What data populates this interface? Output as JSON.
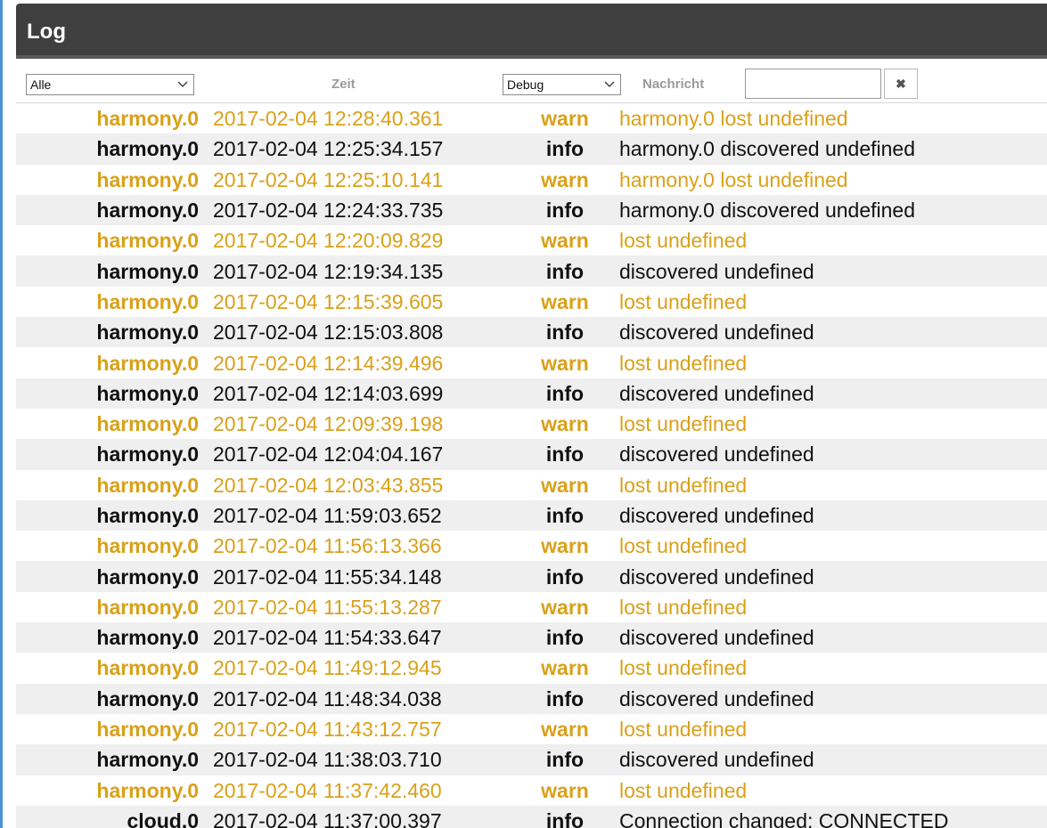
{
  "colors": {
    "warn": "#d9a11a",
    "info": "#111111",
    "header_bg": "#3f3f3f"
  },
  "panel": {
    "title": "Log"
  },
  "filters": {
    "source": {
      "selected": "Alle"
    },
    "time_header": "Zeit",
    "severity": {
      "selected": "Debug"
    },
    "message_header": "Nachricht",
    "message_filter_value": "",
    "clear_icon": "close-icon",
    "clear_glyph": "✖"
  },
  "log_rows": [
    {
      "source": "harmony.0",
      "time": "2017-02-04 12:28:40.361",
      "severity": "warn",
      "message": "harmony.0 lost undefined"
    },
    {
      "source": "harmony.0",
      "time": "2017-02-04 12:25:34.157",
      "severity": "info",
      "message": "harmony.0 discovered undefined"
    },
    {
      "source": "harmony.0",
      "time": "2017-02-04 12:25:10.141",
      "severity": "warn",
      "message": "harmony.0 lost undefined"
    },
    {
      "source": "harmony.0",
      "time": "2017-02-04 12:24:33.735",
      "severity": "info",
      "message": "harmony.0 discovered undefined"
    },
    {
      "source": "harmony.0",
      "time": "2017-02-04 12:20:09.829",
      "severity": "warn",
      "message": "lost undefined"
    },
    {
      "source": "harmony.0",
      "time": "2017-02-04 12:19:34.135",
      "severity": "info",
      "message": "discovered undefined"
    },
    {
      "source": "harmony.0",
      "time": "2017-02-04 12:15:39.605",
      "severity": "warn",
      "message": "lost undefined"
    },
    {
      "source": "harmony.0",
      "time": "2017-02-04 12:15:03.808",
      "severity": "info",
      "message": "discovered undefined"
    },
    {
      "source": "harmony.0",
      "time": "2017-02-04 12:14:39.496",
      "severity": "warn",
      "message": "lost undefined"
    },
    {
      "source": "harmony.0",
      "time": "2017-02-04 12:14:03.699",
      "severity": "info",
      "message": "discovered undefined"
    },
    {
      "source": "harmony.0",
      "time": "2017-02-04 12:09:39.198",
      "severity": "warn",
      "message": "lost undefined"
    },
    {
      "source": "harmony.0",
      "time": "2017-02-04 12:04:04.167",
      "severity": "info",
      "message": "discovered undefined"
    },
    {
      "source": "harmony.0",
      "time": "2017-02-04 12:03:43.855",
      "severity": "warn",
      "message": "lost undefined"
    },
    {
      "source": "harmony.0",
      "time": "2017-02-04 11:59:03.652",
      "severity": "info",
      "message": "discovered undefined"
    },
    {
      "source": "harmony.0",
      "time": "2017-02-04 11:56:13.366",
      "severity": "warn",
      "message": "lost undefined"
    },
    {
      "source": "harmony.0",
      "time": "2017-02-04 11:55:34.148",
      "severity": "info",
      "message": "discovered undefined"
    },
    {
      "source": "harmony.0",
      "time": "2017-02-04 11:55:13.287",
      "severity": "warn",
      "message": "lost undefined"
    },
    {
      "source": "harmony.0",
      "time": "2017-02-04 11:54:33.647",
      "severity": "info",
      "message": "discovered undefined"
    },
    {
      "source": "harmony.0",
      "time": "2017-02-04 11:49:12.945",
      "severity": "warn",
      "message": "lost undefined"
    },
    {
      "source": "harmony.0",
      "time": "2017-02-04 11:48:34.038",
      "severity": "info",
      "message": "discovered undefined"
    },
    {
      "source": "harmony.0",
      "time": "2017-02-04 11:43:12.757",
      "severity": "warn",
      "message": "lost undefined"
    },
    {
      "source": "harmony.0",
      "time": "2017-02-04 11:38:03.710",
      "severity": "info",
      "message": "discovered undefined"
    },
    {
      "source": "harmony.0",
      "time": "2017-02-04 11:37:42.460",
      "severity": "warn",
      "message": "lost undefined"
    },
    {
      "source": "cloud.0",
      "time": "2017-02-04 11:37:00.397",
      "severity": "info",
      "message": "Connection changed: CONNECTED"
    }
  ]
}
